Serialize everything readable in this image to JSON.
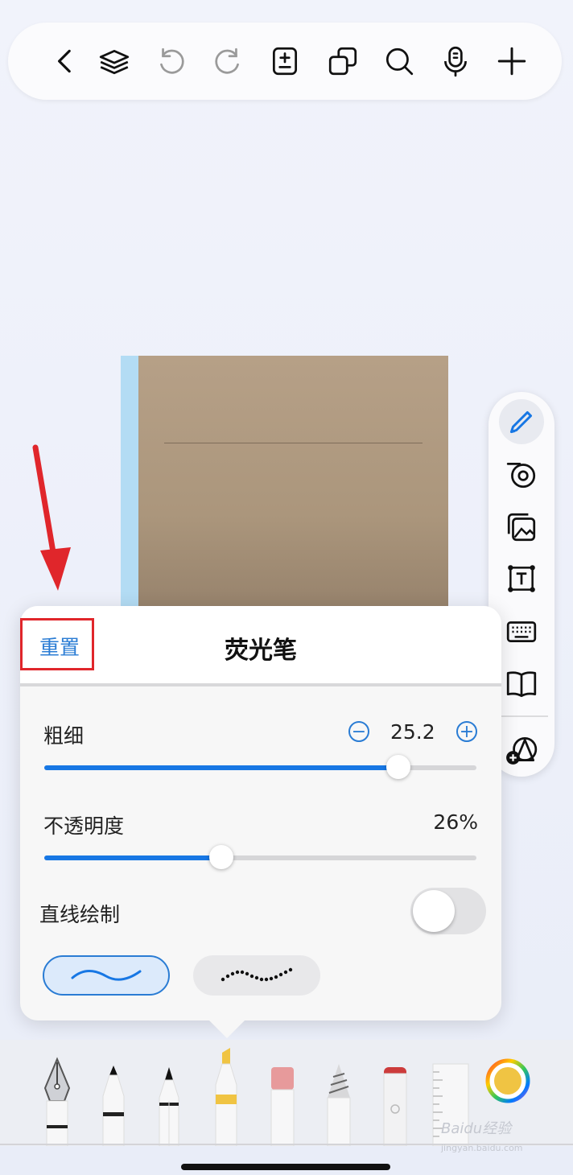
{
  "toolbar": {
    "buttons": [
      "back-icon",
      "layers-icon",
      "undo-icon",
      "redo-icon",
      "page-add-icon",
      "duplicate-icon",
      "search-icon",
      "microphone-icon",
      "add-icon"
    ]
  },
  "side_tools": [
    "pen-icon",
    "tape-icon",
    "image-icon",
    "text-box-icon",
    "keyboard-icon",
    "book-icon",
    "shapes-add-icon"
  ],
  "panel": {
    "reset_label": "重置",
    "title": "荧光笔",
    "thickness": {
      "label": "粗细",
      "value": "25.2",
      "fraction": 0.82
    },
    "opacity": {
      "label": "不透明度",
      "value": "26%",
      "fraction": 0.41
    },
    "straight_line": {
      "label": "直线绘制",
      "enabled": false
    },
    "stroke_styles": [
      "smooth-stroke-icon",
      "dotted-stroke-icon"
    ]
  },
  "tools_tray": [
    "fountain-pen",
    "ballpoint-pen",
    "pencil",
    "highlighter",
    "eraser",
    "lasso",
    "spray",
    "ruler",
    "color-picker"
  ],
  "colors": {
    "accent": "#2a7cd4",
    "highlighter_yellow": "#f0c443",
    "selected_color": "#f0c443"
  },
  "watermark": {
    "brand": "Baidu经验",
    "url": "jingyan.baidu.com"
  }
}
